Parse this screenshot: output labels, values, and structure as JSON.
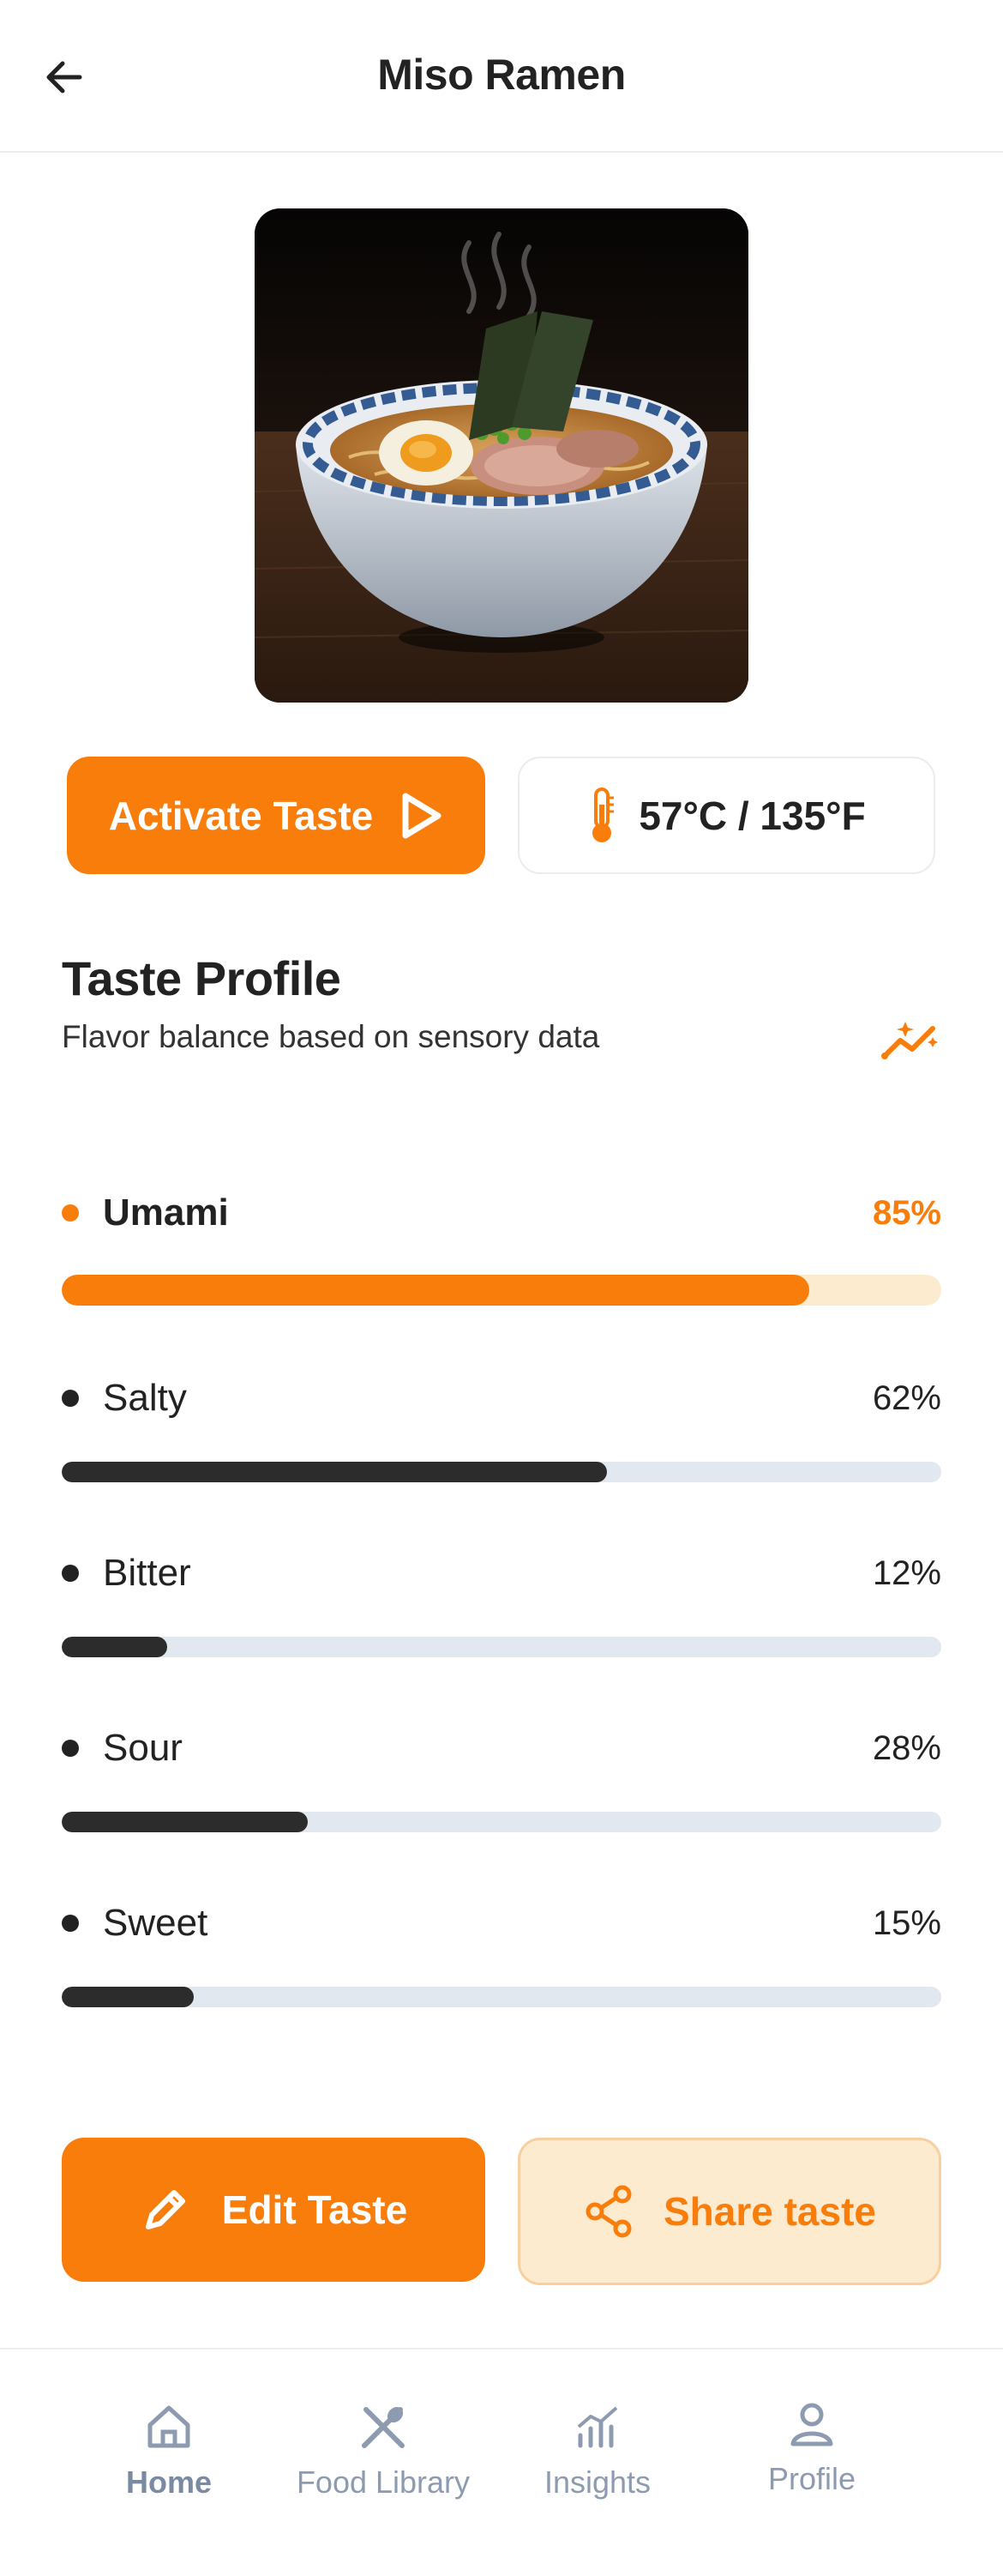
{
  "header": {
    "title": "Miso Ramen",
    "back_icon": "arrow-left-icon"
  },
  "hero": {
    "alt": "Bowl of miso ramen"
  },
  "actions": {
    "activate_label": "Activate Taste",
    "temperature": "57°C / 135°F"
  },
  "taste_profile": {
    "title": "Taste Profile",
    "subtitle": "Flavor balance based on sensory data",
    "items": [
      {
        "name": "Umami",
        "percent_label": "85%",
        "value": 85
      },
      {
        "name": "Salty",
        "percent_label": "62%",
        "value": 62
      },
      {
        "name": "Bitter",
        "percent_label": "12%",
        "value": 12
      },
      {
        "name": "Sour",
        "percent_label": "28%",
        "value": 28
      },
      {
        "name": "Sweet",
        "percent_label": "15%",
        "value": 15
      }
    ]
  },
  "footer_actions": {
    "edit_label": "Edit Taste",
    "share_label": "Share taste"
  },
  "nav": {
    "items": [
      {
        "label": "Home",
        "icon": "home-icon",
        "active": true
      },
      {
        "label": "Food Library",
        "icon": "fork-knife-icon",
        "active": false
      },
      {
        "label": "Insights",
        "icon": "bar-chart-icon",
        "active": false
      },
      {
        "label": "Profile",
        "icon": "user-icon",
        "active": false
      }
    ]
  },
  "colors": {
    "accent": "#f97d0b",
    "accent_soft": "#fdebd0",
    "bar_dark": "#2c2c2c",
    "track": "#e2e8ef",
    "nav_gray": "#8d9bb0"
  }
}
